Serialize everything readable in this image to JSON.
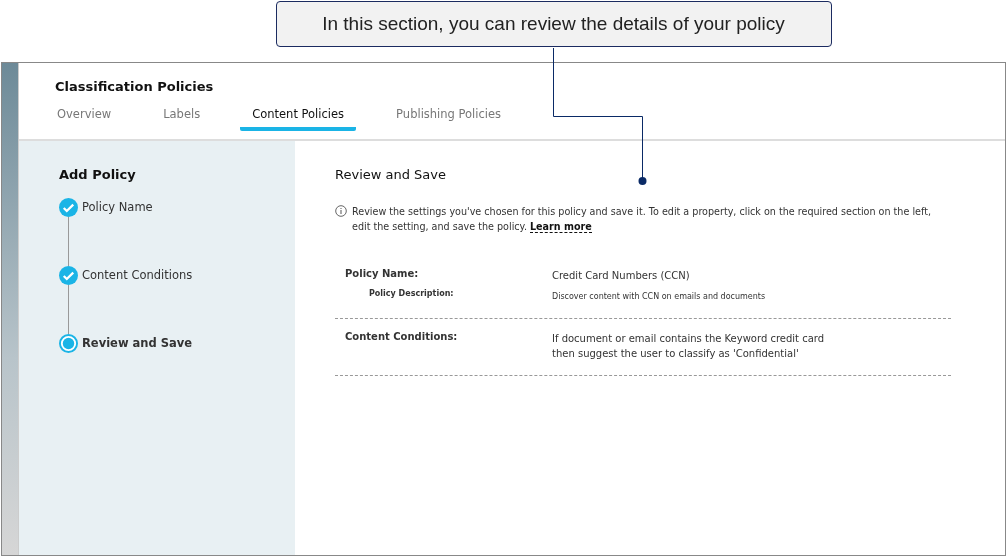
{
  "callout": {
    "text": "In this section, you can review the details of your policy"
  },
  "header": {
    "title": "Classification Policies"
  },
  "tabs": [
    {
      "label": "Overview",
      "selected": false
    },
    {
      "label": "Labels",
      "selected": false
    },
    {
      "label": "Content Policies",
      "selected": true
    },
    {
      "label": "Publishing Policies",
      "selected": false
    }
  ],
  "sidebar": {
    "title": "Add Policy",
    "steps": [
      {
        "label": "Policy Name",
        "completed": true,
        "selected": false
      },
      {
        "label": "Content Conditions",
        "completed": true,
        "selected": false
      },
      {
        "label": "Review and Save",
        "completed": false,
        "selected": true
      }
    ]
  },
  "content": {
    "title": "Review and Save",
    "info": "Review the settings you've chosen for this policy and save it. To edit a property, click on the required section on the left, edit the setting, and save the policy.",
    "link": "Learn more",
    "sections": [
      {
        "label": "Policy Name:",
        "value": "Credit Card Numbers (CCN)",
        "sub_label": "Policy Description:",
        "sub_value": "Discover content with CCN on emails and documents"
      },
      {
        "label": "Content Conditions:",
        "value": "If document or email contains the Keyword credit card then suggest the user to classify as 'Confidential'"
      }
    ]
  }
}
